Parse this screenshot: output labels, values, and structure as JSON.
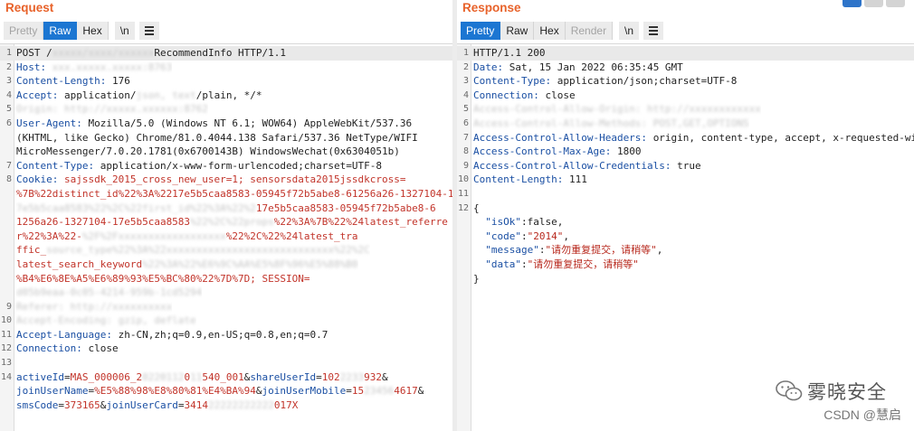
{
  "request": {
    "title": "Request",
    "tabs": [
      {
        "label": "Pretty",
        "state": "disabled"
      },
      {
        "label": "Raw",
        "state": "active"
      },
      {
        "label": "Hex",
        "state": "normal"
      }
    ],
    "newline_label": "\\n",
    "lines": [
      {
        "n": "1",
        "hl": true,
        "parts": [
          {
            "t": "POST /"
          },
          {
            "t": "xxxxx/xxxx/xxxxxx",
            "c": "blur"
          },
          {
            "t": "RecommendInfo HTTP/1.1"
          }
        ]
      },
      {
        "n": "2",
        "parts": [
          {
            "t": "Host: ",
            "c": "k"
          },
          {
            "t": "xxx.xxxxx.xxxxx:8763",
            "c": "blur"
          }
        ]
      },
      {
        "n": "3",
        "parts": [
          {
            "t": "Content-Length: ",
            "c": "k"
          },
          {
            "t": "176"
          }
        ]
      },
      {
        "n": "4",
        "parts": [
          {
            "t": "Accept: ",
            "c": "k"
          },
          {
            "t": "application/"
          },
          {
            "t": "json, text",
            "c": "blur"
          },
          {
            "t": "/plain, */*"
          }
        ]
      },
      {
        "n": "5",
        "parts": [
          {
            "t": "Origin: http://xxxxx.xxxxxx:8762",
            "c": "blur"
          }
        ]
      },
      {
        "n": "6",
        "parts": [
          {
            "t": "User-Agent: ",
            "c": "k"
          },
          {
            "t": "Mozilla/5.0 (Windows NT 6.1; WOW64) AppleWebKit/537.36"
          }
        ]
      },
      {
        "n": "",
        "parts": [
          {
            "t": "(KHTML, like Gecko) Chrome/81.0.4044.138 Safari/537.36 NetType/WIFI"
          }
        ]
      },
      {
        "n": "",
        "parts": [
          {
            "t": "MicroMessenger/7.0.20.1781(0x6700143B) WindowsWechat(0x6304051b)"
          }
        ]
      },
      {
        "n": "7",
        "parts": [
          {
            "t": "Content-Type: ",
            "c": "k"
          },
          {
            "t": "application/x-www-form-urlencoded;charset=UTF-8"
          }
        ]
      },
      {
        "n": "8",
        "parts": [
          {
            "t": "Cookie: ",
            "c": "k"
          },
          {
            "t": "sajssdk_2015_cross_new_user=1; sensorsdata2015jssdkcross=",
            "c": "p"
          }
        ]
      },
      {
        "n": "",
        "parts": [
          {
            "t": "%7B%22distinct_id%22%3A%2217e5b5caa8583-05945f72b5abe8-61256a26-1327104-1",
            "c": "p"
          }
        ]
      },
      {
        "n": "",
        "parts": [
          {
            "t": "7e5b5caa8583%22%2C%22first_id%22%3A%22%2",
            "c": "blur"
          },
          {
            "t": "17e5b5caa8583-05945f72b5abe8-6",
            "c": "p"
          }
        ]
      },
      {
        "n": "",
        "parts": [
          {
            "t": "1256a26-1327104-17e5b5caa8583",
            "c": "p"
          },
          {
            "t": "%22%2C%22props",
            "c": "blur"
          },
          {
            "t": "%22%3A%7B%22%24latest_referre",
            "c": "p"
          }
        ]
      },
      {
        "n": "",
        "parts": [
          {
            "t": "r%22%3A%22-",
            "c": "p"
          },
          {
            "t": "%2F%2Fxxxxxxxxxxxxxxxxxx",
            "c": "blur"
          },
          {
            "t": "%22%2C%22%24latest_tra",
            "c": "p"
          }
        ]
      },
      {
        "n": "",
        "parts": [
          {
            "t": "ffic_",
            "c": "p"
          },
          {
            "t": "source_type%22%3A%22xxxxxxxxxxxxxxxxxxxxxxxxxxxx%22%2C",
            "c": "blur"
          }
        ]
      },
      {
        "n": "",
        "parts": [
          {
            "t": "latest_search_keyword",
            "c": "p"
          },
          {
            "t": "%22%3A%22%E6%9C%AA%E5%8F%96%E5%88%B0",
            "c": "blur"
          }
        ]
      },
      {
        "n": "",
        "parts": [
          {
            "t": "%B4%E6%8E%A5%E6%89%93%E5%BC%80%22%7D%7D; SESSION=",
            "c": "p"
          }
        ]
      },
      {
        "n": "",
        "parts": [
          {
            "t": "d05b9eaa-0c05-4214-959b-1cd5294",
            "c": "blur"
          }
        ]
      },
      {
        "n": "9",
        "parts": [
          {
            "t": "Referer: http://xxxxxxxxxx",
            "c": "blur"
          }
        ]
      },
      {
        "n": "10",
        "parts": [
          {
            "t": "Accept-Encoding: gzip, deflate",
            "c": "blur"
          }
        ]
      },
      {
        "n": "11",
        "parts": [
          {
            "t": "Accept-Language: ",
            "c": "k"
          },
          {
            "t": "zh-CN,zh;q=0.9,en-US;q=0.8,en;q=0.7"
          }
        ]
      },
      {
        "n": "12",
        "parts": [
          {
            "t": "Connection: ",
            "c": "k"
          },
          {
            "t": "close"
          }
        ]
      },
      {
        "n": "13",
        "parts": []
      },
      {
        "n": "14",
        "parts": [
          {
            "t": "activeId",
            "c": "k"
          },
          {
            "t": "="
          },
          {
            "t": "MAS_000006_2",
            "c": "p"
          },
          {
            "t": "0220112",
            "c": "blur"
          },
          {
            "t": "0",
            "c": "p"
          },
          {
            "t": "11",
            "c": "blur"
          },
          {
            "t": "540_001",
            "c": "p"
          },
          {
            "t": "&"
          },
          {
            "t": "shareUserId",
            "c": "k"
          },
          {
            "t": "="
          },
          {
            "t": "102",
            "c": "p"
          },
          {
            "t": "2233",
            "c": "blur"
          },
          {
            "t": "932",
            "c": "p"
          },
          {
            "t": "&"
          }
        ]
      },
      {
        "n": "",
        "parts": [
          {
            "t": "joinUserName",
            "c": "k"
          },
          {
            "t": "="
          },
          {
            "t": "%E5%88%98%E8%80%81%E4%BA%94",
            "c": "p"
          },
          {
            "t": "&"
          },
          {
            "t": "joinUserMobile",
            "c": "k"
          },
          {
            "t": "="
          },
          {
            "t": "15",
            "c": "p"
          },
          {
            "t": "23456",
            "c": "blur"
          },
          {
            "t": "4617",
            "c": "p"
          },
          {
            "t": "&"
          }
        ]
      },
      {
        "n": "",
        "parts": [
          {
            "t": "smsCode",
            "c": "k"
          },
          {
            "t": "="
          },
          {
            "t": "373165",
            "c": "p"
          },
          {
            "t": "&"
          },
          {
            "t": "joinUserCard",
            "c": "k"
          },
          {
            "t": "="
          },
          {
            "t": "3414",
            "c": "p"
          },
          {
            "t": "22222222222",
            "c": "blur"
          },
          {
            "t": "017X",
            "c": "p"
          }
        ]
      }
    ]
  },
  "response": {
    "title": "Response",
    "tabs": [
      {
        "label": "Pretty",
        "state": "active"
      },
      {
        "label": "Raw",
        "state": "normal"
      },
      {
        "label": "Hex",
        "state": "normal"
      },
      {
        "label": "Render",
        "state": "disabled"
      }
    ],
    "newline_label": "\\n",
    "lines": [
      {
        "n": "1",
        "hl": true,
        "parts": [
          {
            "t": "HTTP/1.1 200"
          }
        ]
      },
      {
        "n": "2",
        "parts": [
          {
            "t": "Date: ",
            "c": "k"
          },
          {
            "t": "Sat, 15 Jan 2022 06:35:45 GMT"
          }
        ]
      },
      {
        "n": "3",
        "parts": [
          {
            "t": "Content-Type: ",
            "c": "k"
          },
          {
            "t": "application/json;charset=UTF-8"
          }
        ]
      },
      {
        "n": "4",
        "parts": [
          {
            "t": "Connection: ",
            "c": "k"
          },
          {
            "t": "close"
          }
        ]
      },
      {
        "n": "5",
        "parts": [
          {
            "t": "Access-Control-Allow-Origin: http://xxxxxxxxxxxx",
            "c": "blur"
          }
        ]
      },
      {
        "n": "6",
        "parts": [
          {
            "t": "Access-Control-Allow-Methods: POST,GET,OPTIONS",
            "c": "blur"
          }
        ]
      },
      {
        "n": "7",
        "parts": [
          {
            "t": "Access-Control-Allow-Headers: ",
            "c": "k"
          },
          {
            "t": "origin, content-type, accept, x-requested-wi"
          }
        ]
      },
      {
        "n": "8",
        "parts": [
          {
            "t": "Access-Control-Max-Age: ",
            "c": "k"
          },
          {
            "t": "1800"
          }
        ]
      },
      {
        "n": "9",
        "parts": [
          {
            "t": "Access-Control-Allow-Credentials: ",
            "c": "k"
          },
          {
            "t": "true"
          }
        ]
      },
      {
        "n": "10",
        "parts": [
          {
            "t": "Content-Length: ",
            "c": "k"
          },
          {
            "t": "111"
          }
        ]
      },
      {
        "n": "11",
        "parts": []
      },
      {
        "n": "12",
        "parts": [
          {
            "t": "{"
          }
        ]
      },
      {
        "n": "",
        "parts": [
          {
            "t": "  \"isOk\"",
            "c": "k"
          },
          {
            "t": ":false,"
          }
        ]
      },
      {
        "n": "",
        "parts": [
          {
            "t": "  \"code\"",
            "c": "k"
          },
          {
            "t": ":"
          },
          {
            "t": "\"2014\"",
            "c": "j"
          },
          {
            "t": ","
          }
        ]
      },
      {
        "n": "",
        "parts": [
          {
            "t": "  \"message\"",
            "c": "k"
          },
          {
            "t": ":"
          },
          {
            "t": "\"请勿重复提交，请稍等\"",
            "c": "j"
          },
          {
            "t": ","
          }
        ]
      },
      {
        "n": "",
        "parts": [
          {
            "t": "  \"data\"",
            "c": "k"
          },
          {
            "t": ":"
          },
          {
            "t": "\"请勿重复提交，请稍等\"",
            "c": "j"
          }
        ]
      },
      {
        "n": "",
        "parts": [
          {
            "t": "}"
          }
        ]
      }
    ]
  },
  "watermark": {
    "brand": "雾晓安全",
    "sub": "CSDN @慧启"
  }
}
